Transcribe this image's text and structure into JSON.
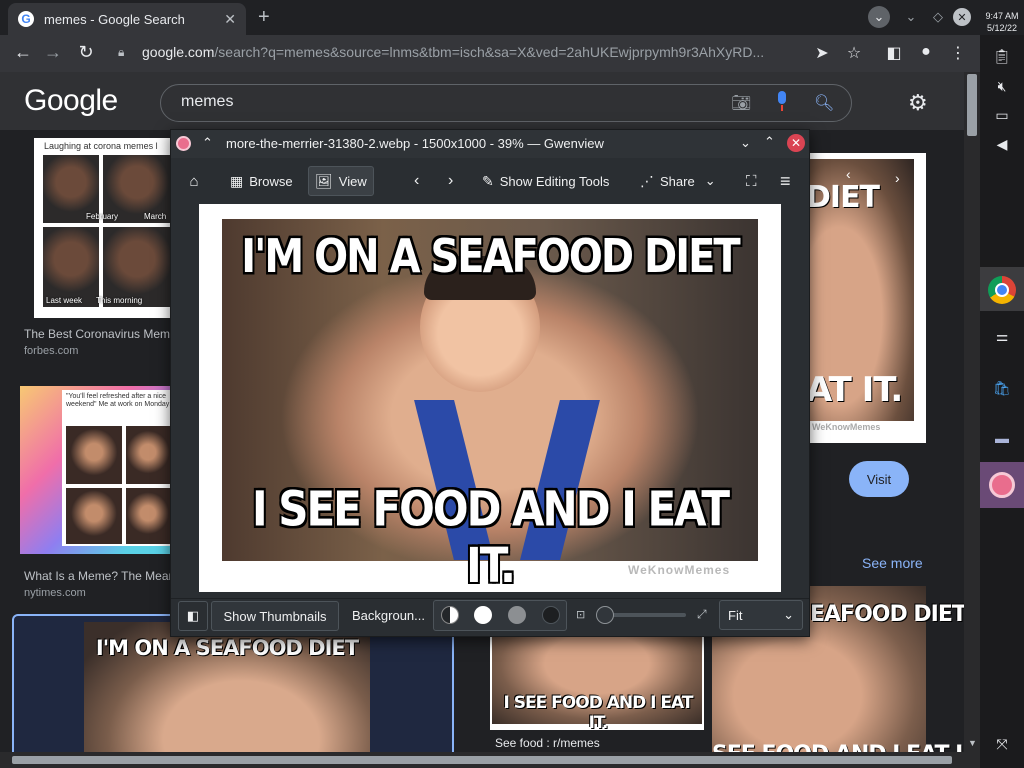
{
  "browser": {
    "tab_title": "memes - Google Search",
    "tab_favicon": "G",
    "new_tab": "+",
    "url_host": "google.com",
    "url_path": "/search?q=memes&source=lnms&tbm=isch&sa=X&ved=2ahUKEwjprpymh9r3AhXyRD..."
  },
  "clock": {
    "time": "9:47 AM",
    "date": "5/12/22"
  },
  "google": {
    "logo": "Google",
    "query": "memes",
    "results": [
      {
        "title": "The Best Coronavirus Memes",
        "source": "forbes.com",
        "caption": "Laughing at corona memes l",
        "labels": [
          "February",
          "March",
          "Last week",
          "This morning"
        ]
      },
      {
        "title": "What Is a Meme? The Meaning",
        "source": "nytimes.com",
        "caption": "\"You'll feel refreshed after a nice weekend\" Me at work on Monday:"
      }
    ],
    "preview": {
      "top_text": "DIET",
      "bottom_text": "AT IT.",
      "watermark": "WeKnowMemes",
      "visit": "Visit",
      "see_more": "See more"
    },
    "selected_meme_text": "I'M ON A SEAFOOD DIET",
    "bottom_results": [
      {
        "meme_text": "I SEE FOOD AND I EAT IT.",
        "caption": "See food : r/memes"
      },
      {
        "meme_text": "EAFOOD DIET",
        "meme_text_bottom": "SEE FOOD AND I EAT I"
      }
    ]
  },
  "gwenview": {
    "window_title": "more-the-merrier-31380-2.webp - 1500x1000 - 39% — Gwenview",
    "toolbar": {
      "browse": "Browse",
      "view": "View",
      "edit": "Show Editing Tools",
      "share": "Share"
    },
    "meme": {
      "top": "I'M ON A SEAFOOD DIET",
      "bottom": "I SEE FOOD AND I EAT IT.",
      "watermark": "WeKnowMemes"
    },
    "statusbar": {
      "thumbnails": "Show Thumbnails",
      "background": "Backgroun...",
      "zoom_mode": "Fit"
    },
    "accent_close": "#da4453"
  }
}
